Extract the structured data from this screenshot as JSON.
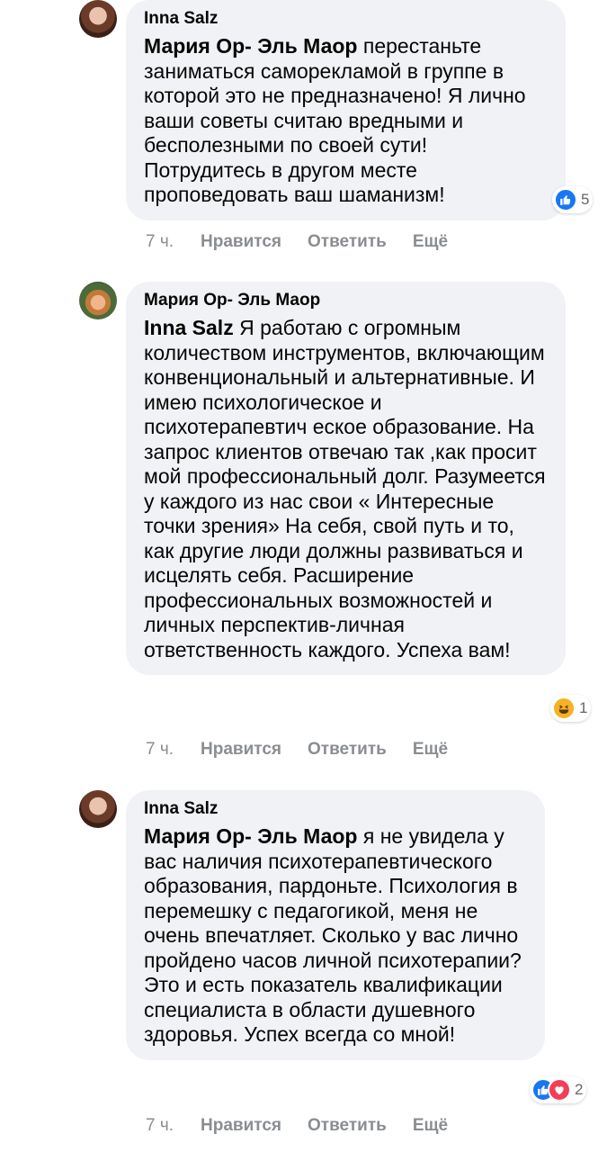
{
  "comments": [
    {
      "author": "Inna Salz",
      "mention": "Мария Ор- Эль Маор",
      "text": " перестаньте заниматься саморекламой в группе в которой это не предназначено! Я лично ваши советы считаю вредными и бесполезными по своей сути! Потрудитесь в другом месте проповедовать ваш шаманизм!",
      "reactions": [
        "like"
      ],
      "reaction_count": "5",
      "time": "7 ч.",
      "like_label": "Нравится",
      "reply_label": "Ответить",
      "more_label": "Ещё"
    },
    {
      "author": "Мария Ор- Эль Маор",
      "mention": "Inna Salz",
      "text": " Я работаю с огромным количеством инструментов, включающим конвенциональный и альтернативные. И имею психологическое и психотерапевтич еское образование. На запрос клиентов отвечаю так ,как просит мой профессиональный долг. Разумеется у каждого из нас свои « Интересные точки зрения» На себя, свой путь и то, как другие люди должны развиваться и исцелять себя. Расширение профессиональных возможностей и личных перспектив-личная ответственность каждого. Успеха вам!",
      "reactions": [
        "haha"
      ],
      "reaction_count": "1",
      "time": "7 ч.",
      "like_label": "Нравится",
      "reply_label": "Ответить",
      "more_label": "Ещё"
    },
    {
      "author": "Inna Salz",
      "mention": "Мария Ор- Эль Маор",
      "text": " я не увидела у вас наличия психотерапевтического образования, пардоньте. Психология в перемешку с педагогикой, меня не очень впечатляет. Сколько у вас лично пройдено часов личной психотерапии? Это и есть показатель квалификации специалиста в области душевного здоровья. Успех всегда со мной!",
      "reactions": [
        "like",
        "love"
      ],
      "reaction_count": "2",
      "time": "7 ч.",
      "like_label": "Нравится",
      "reply_label": "Ответить",
      "more_label": "Ещё"
    }
  ],
  "icons": {
    "like": "thumbs-up-icon",
    "love": "heart-icon",
    "haha": "laughing-face-icon"
  },
  "colors": {
    "bubble": "#f0f2f5",
    "meta_text": "#8a8d91",
    "like_blue": "#1877f2",
    "love_red": "#f33e58",
    "haha_yellow": "#f7b125"
  }
}
